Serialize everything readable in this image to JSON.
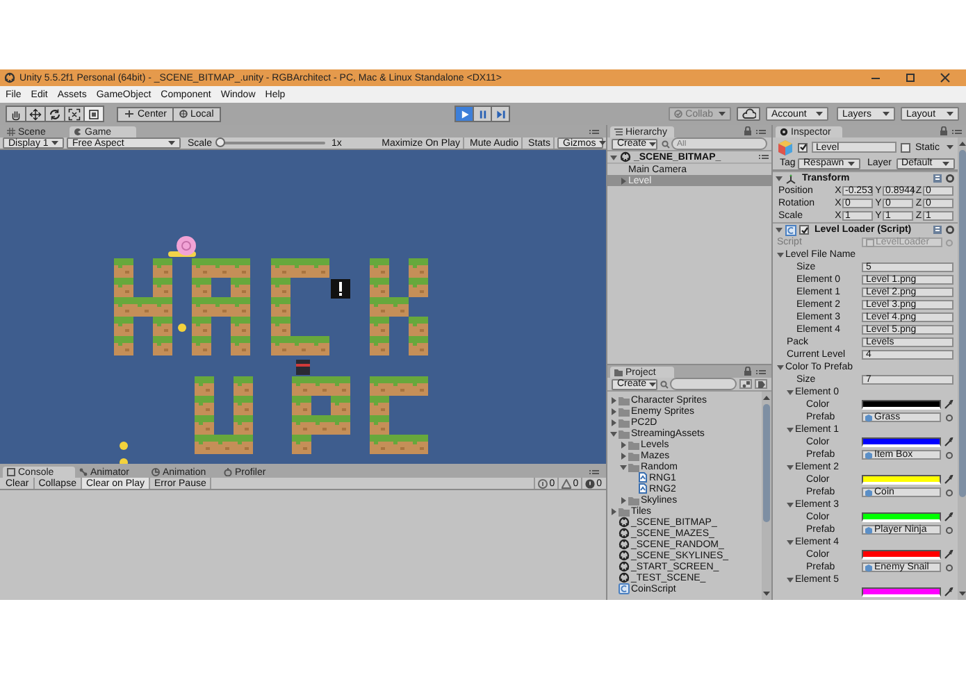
{
  "window": {
    "title": "Unity 5.5.2f1 Personal (64bit) - _SCENE_BITMAP_.unity - RGBArchitect - PC, Mac & Linux Standalone <DX11>"
  },
  "menu": [
    "File",
    "Edit",
    "Assets",
    "GameObject",
    "Component",
    "Window",
    "Help"
  ],
  "toolbar": {
    "tools": [
      {
        "kind": "hand",
        "selected": false
      },
      {
        "kind": "move",
        "selected": false
      },
      {
        "kind": "rotate",
        "selected": false
      },
      {
        "kind": "scale",
        "selected": false
      },
      {
        "kind": "rect",
        "selected": true
      }
    ],
    "pivot": [
      "Center",
      "Local"
    ],
    "play": [
      {
        "kind": "play",
        "selected": true
      },
      {
        "kind": "pause",
        "selected": false
      },
      {
        "kind": "step",
        "selected": false
      }
    ],
    "collab": "Collab",
    "account": "Account",
    "layers": "Layers",
    "layout": "Layout"
  },
  "game": {
    "tabs": [
      {
        "label": "Scene",
        "selected": false
      },
      {
        "label": "Game",
        "selected": true
      }
    ],
    "display": "Display 1",
    "aspect": "Free Aspect",
    "scale": {
      "label": "Scale",
      "level": 0,
      "reading": "1x"
    },
    "buttons": [
      "Maximize On Play",
      "Mute Audio",
      "Stats",
      "Gizmos"
    ]
  },
  "console": {
    "tabs": [
      {
        "label": "Console",
        "selected": true
      },
      {
        "label": "Animator",
        "selected": false
      },
      {
        "label": "Animation",
        "selected": false
      },
      {
        "label": "Profiler",
        "selected": false
      }
    ],
    "buttons": [
      {
        "label": "Clear",
        "on": false
      },
      {
        "label": "Collapse",
        "on": false
      },
      {
        "label": "Clear on Play",
        "on": true
      },
      {
        "label": "Error Pause",
        "on": false
      }
    ],
    "counts": [
      {
        "kind": "info",
        "count": "0"
      },
      {
        "kind": "warning",
        "count": "0"
      },
      {
        "kind": "error",
        "count": "0"
      }
    ]
  },
  "hierarchy": {
    "title": "Hierarchy",
    "create": "Create",
    "search": {
      "placeholder": "All"
    },
    "scene": {
      "label": "_SCENE_BITMAP_",
      "expanded": true,
      "children": [
        {
          "label": "Main Camera",
          "kind": "leaf",
          "selected": false
        },
        {
          "label": "Level",
          "kind": "node",
          "expanded": false,
          "selected": true
        }
      ]
    }
  },
  "project": {
    "title": "Project",
    "create": "Create",
    "tree": [
      {
        "label": "Character Sprites",
        "kind": "folder",
        "expanded": false
      },
      {
        "label": "Enemy Sprites",
        "kind": "folder",
        "expanded": false
      },
      {
        "label": "PC2D",
        "kind": "folder",
        "expanded": false
      },
      {
        "label": "StreamingAssets",
        "kind": "folder",
        "expanded": true,
        "children": [
          {
            "label": "Levels",
            "kind": "folder",
            "expanded": false
          },
          {
            "label": "Mazes",
            "kind": "folder",
            "expanded": false
          },
          {
            "label": "Random",
            "kind": "folder",
            "expanded": true,
            "children": [
              {
                "label": "RNG1",
                "kind": "file"
              },
              {
                "label": "RNG2",
                "kind": "file"
              }
            ]
          },
          {
            "label": "Skylines",
            "kind": "folder",
            "expanded": false
          }
        ]
      },
      {
        "label": "Tiles",
        "kind": "folder",
        "expanded": false
      },
      {
        "label": "_SCENE_BITMAP_",
        "kind": "scene"
      },
      {
        "label": "_SCENE_MAZES_",
        "kind": "scene"
      },
      {
        "label": "_SCENE_RANDOM_",
        "kind": "scene"
      },
      {
        "label": "_SCENE_SKYLINES_",
        "kind": "scene"
      },
      {
        "label": "_START_SCREEN_",
        "kind": "scene"
      },
      {
        "label": "_TEST_SCENE_",
        "kind": "scene"
      },
      {
        "label": "CoinScript",
        "kind": "script"
      }
    ]
  },
  "inspector": {
    "title": "Inspector",
    "object": {
      "name": "Level",
      "active": true,
      "static_label": "Static",
      "static": false,
      "tag_label": "Tag",
      "tag": "Respawn",
      "layer_label": "Layer",
      "layer": "Default"
    },
    "transform": {
      "title": "Transform",
      "expanded": true,
      "rows": [
        {
          "label": "Position",
          "axes": [
            {
              "axis": "X",
              "value": "-0.253"
            },
            {
              "axis": "Y",
              "value": "0.8944"
            },
            {
              "axis": "Z",
              "value": "0"
            }
          ]
        },
        {
          "label": "Rotation",
          "axes": [
            {
              "axis": "X",
              "value": "0"
            },
            {
              "axis": "Y",
              "value": "0"
            },
            {
              "axis": "Z",
              "value": "0"
            }
          ]
        },
        {
          "label": "Scale",
          "axes": [
            {
              "axis": "X",
              "value": "1"
            },
            {
              "axis": "Y",
              "value": "1"
            },
            {
              "axis": "Z",
              "value": "1"
            }
          ]
        }
      ]
    },
    "script": {
      "title": "Level Loader (Script)",
      "expanded": true,
      "enabled": true,
      "script_label": "Script",
      "script": "LevelLoader",
      "fields": [
        {
          "kind": "group",
          "label": "Level File Name",
          "expanded": true,
          "children": [
            {
              "kind": "text",
              "label": "Size",
              "value": "5"
            },
            {
              "kind": "text",
              "label": "Element 0",
              "value": "Level 1.png"
            },
            {
              "kind": "text",
              "label": "Element 1",
              "value": "Level 2.png"
            },
            {
              "kind": "text",
              "label": "Element 2",
              "value": "Level 3.png"
            },
            {
              "kind": "text",
              "label": "Element 3",
              "value": "Level 4.png"
            },
            {
              "kind": "text",
              "label": "Element 4",
              "value": "Level 5.png"
            }
          ]
        },
        {
          "kind": "text",
          "label": "Pack",
          "value": "Levels"
        },
        {
          "kind": "text",
          "label": "Current Level",
          "value": "4"
        },
        {
          "kind": "group",
          "label": "Color To Prefab",
          "expanded": true,
          "children": [
            {
              "kind": "text",
              "label": "Size",
              "value": "7"
            },
            {
              "kind": "group",
              "label": "Element 0",
              "expanded": true,
              "children": [
                {
                  "kind": "color",
                  "label": "Color",
                  "color": "#000000"
                },
                {
                  "kind": "object",
                  "label": "Prefab",
                  "value": "Grass"
                }
              ]
            },
            {
              "kind": "group",
              "label": "Element 1",
              "expanded": true,
              "children": [
                {
                  "kind": "color",
                  "label": "Color",
                  "color": "#0000ff"
                },
                {
                  "kind": "object",
                  "label": "Prefab",
                  "value": "Item Box"
                }
              ]
            },
            {
              "kind": "group",
              "label": "Element 2",
              "expanded": true,
              "children": [
                {
                  "kind": "color",
                  "label": "Color",
                  "color": "#ffff00"
                },
                {
                  "kind": "object",
                  "label": "Prefab",
                  "value": "Coin"
                }
              ]
            },
            {
              "kind": "group",
              "label": "Element 3",
              "expanded": true,
              "children": [
                {
                  "kind": "color",
                  "label": "Color",
                  "color": "#00ff00"
                },
                {
                  "kind": "object",
                  "label": "Prefab",
                  "value": "Player Ninja"
                }
              ]
            },
            {
              "kind": "group",
              "label": "Element 4",
              "expanded": true,
              "children": [
                {
                  "kind": "color",
                  "label": "Color",
                  "color": "#ff0000"
                },
                {
                  "kind": "object",
                  "label": "Prefab",
                  "value": "Enemy Snail"
                }
              ]
            },
            {
              "kind": "group",
              "label": "Element 5",
              "expanded": true,
              "children": [
                {
                  "kind": "color",
                  "color": "#ff00ff"
                }
              ]
            }
          ]
        }
      ]
    }
  }
}
